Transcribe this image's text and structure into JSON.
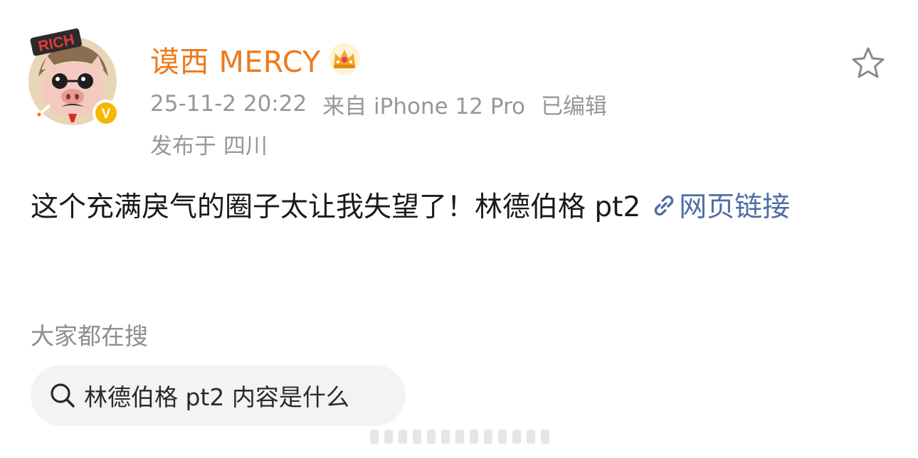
{
  "post": {
    "author": {
      "name": "谟西 MERCY",
      "avatar_badge_text": "RICH",
      "verified_badge_text": "V"
    },
    "meta": {
      "timestamp": "25-11-2 20:22",
      "source": "来自 iPhone 12 Pro",
      "edited": "已编辑",
      "location": "发布于 四川"
    },
    "content": {
      "text": "这个充满戾气的圈子太让我失望了！林德伯格 pt2",
      "link_label_part1": "网页",
      "link_label_part2": "链接"
    }
  },
  "search": {
    "title": "大家都在搜",
    "suggestion": "林德伯格 pt2 内容是什么"
  },
  "colors": {
    "username": "#ef7a1b",
    "meta": "#979797",
    "link": "#4f6ea6",
    "chip_bg": "#f3f3f3",
    "verified_badge": "#f5b700"
  },
  "icons": {
    "favorite": "star-outline-icon",
    "crown": "crown-icon",
    "link": "link-icon",
    "search": "search-icon",
    "verified": "verified-badge-icon"
  }
}
